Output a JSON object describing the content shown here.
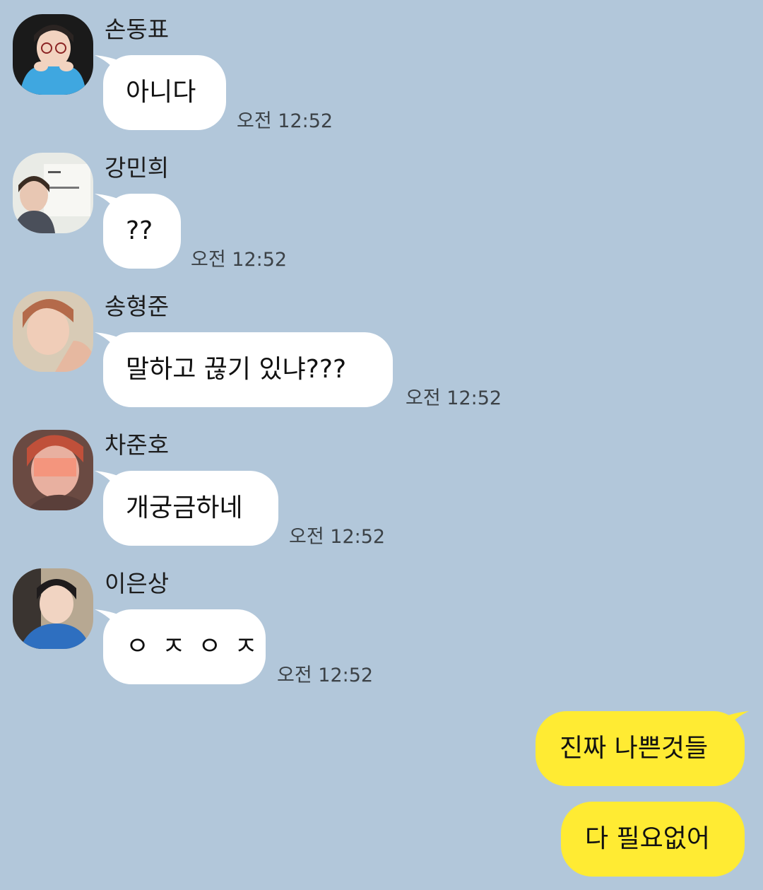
{
  "colors": {
    "background": "#b2c7da",
    "incoming_bubble": "#ffffff",
    "outgoing_bubble": "#ffeb33"
  },
  "incoming": [
    {
      "sender": "손동표",
      "text": "아니다",
      "time": "오전 12:52",
      "avatar": "profile-photo-glasses"
    },
    {
      "sender": "강민희",
      "text": "??",
      "time": "오전 12:52",
      "avatar": "profile-photo-nametag"
    },
    {
      "sender": "송형준",
      "text": "말하고 끊기 있냐???",
      "time": "오전 12:52",
      "avatar": "profile-photo-redhair"
    },
    {
      "sender": "차준호",
      "text": "개궁금하네",
      "time": "오전 12:52",
      "avatar": "profile-photo-sunlight"
    },
    {
      "sender": "이은상",
      "text": "ㅇㅈㅇㅈ",
      "time": "오전 12:52",
      "avatar": "profile-photo-car"
    }
  ],
  "outgoing": [
    {
      "text": "진짜 나쁜것들"
    },
    {
      "text": "다 필요없어"
    }
  ]
}
